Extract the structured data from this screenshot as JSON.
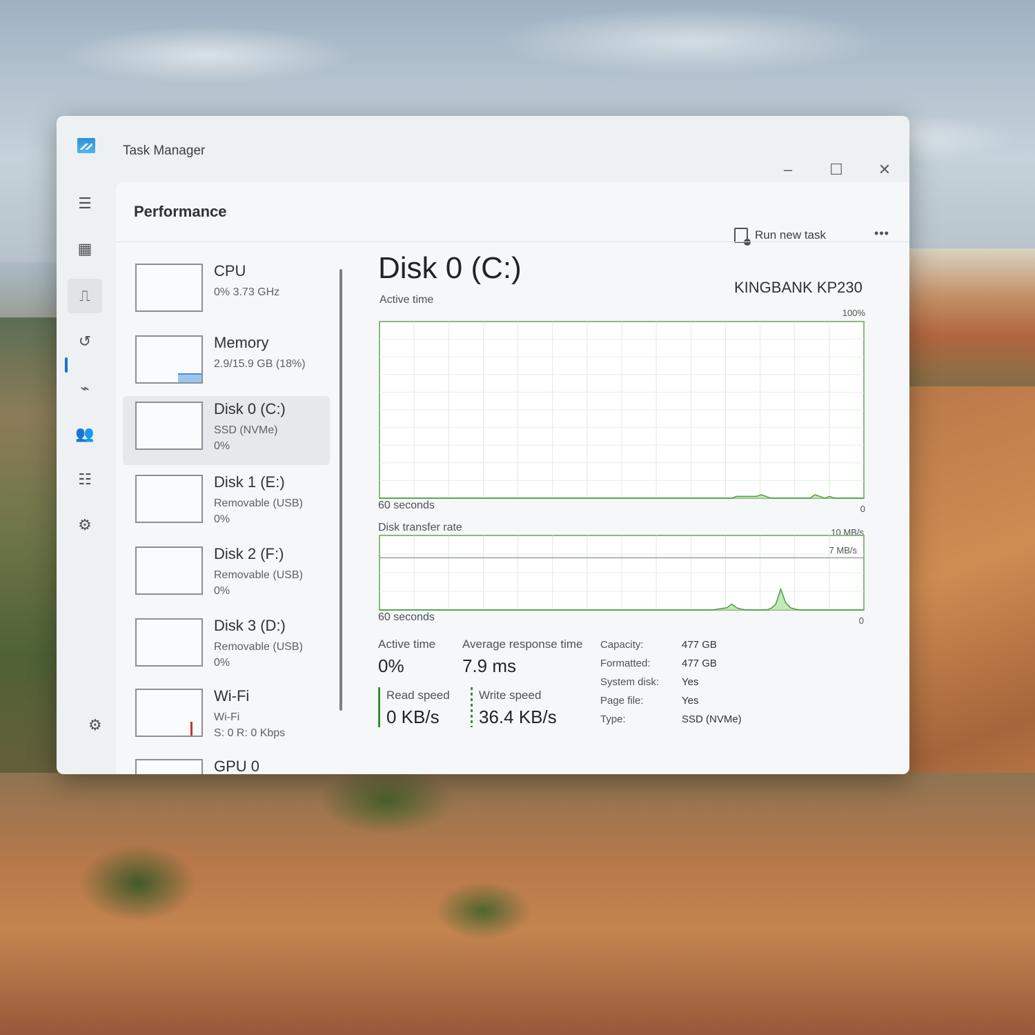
{
  "window": {
    "title": "Task Manager"
  },
  "icons": {
    "app": "task-manager-app-icon",
    "minimize": "minimize-icon",
    "maximize": "maximize-icon",
    "close": "close-icon",
    "run_task": "run-new-task-icon",
    "more": "more-options-icon",
    "settings": "settings-icon"
  },
  "nav": [
    {
      "name": "hamburger-menu-icon",
      "glyph": "☰"
    },
    {
      "name": "processes-icon",
      "glyph": "▦"
    },
    {
      "name": "performance-icon",
      "glyph": "⎍"
    },
    {
      "name": "app-history-icon",
      "glyph": "↺"
    },
    {
      "name": "startup-apps-icon",
      "glyph": "⌁"
    },
    {
      "name": "users-icon",
      "glyph": "👥"
    },
    {
      "name": "details-icon",
      "glyph": "☷"
    },
    {
      "name": "services-icon",
      "glyph": "⚙"
    }
  ],
  "header": {
    "title": "Performance",
    "run_new_task": "Run new task",
    "more": "•••"
  },
  "devices": [
    {
      "name": "CPU",
      "sub1": "0% 3.73 GHz",
      "sub2": "",
      "sub3": ""
    },
    {
      "name": "Memory",
      "sub1": "2.9/15.9 GB (18%)",
      "sub2": "",
      "sub3": ""
    },
    {
      "name": "Disk 0 (C:)",
      "sub1": "SSD (NVMe)",
      "sub2": "0%",
      "sub3": ""
    },
    {
      "name": "Disk 1 (E:)",
      "sub1": "Removable (USB)",
      "sub2": "0%",
      "sub3": ""
    },
    {
      "name": "Disk 2 (F:)",
      "sub1": "Removable (USB)",
      "sub2": "0%",
      "sub3": ""
    },
    {
      "name": "Disk 3 (D:)",
      "sub1": "Removable (USB)",
      "sub2": "0%",
      "sub3": ""
    },
    {
      "name": "Wi-Fi",
      "sub1": "Wi-Fi",
      "sub2": "S: 0 R: 0 Kbps",
      "sub3": ""
    },
    {
      "name": "GPU 0",
      "sub1": "",
      "sub2": "",
      "sub3": ""
    }
  ],
  "memory_usage_fraction": 0.18,
  "detail": {
    "title": "Disk 0 (C:)",
    "model": "KINGBANK KP230",
    "active_chart": {
      "label": "Active time",
      "max_label": "100%",
      "min_label": "0",
      "time_label": "60 seconds"
    },
    "transfer_chart": {
      "label": "Disk transfer rate",
      "max_label": "10 MB/s",
      "mid_label": "7 MB/s",
      "min_label": "0",
      "time_label": "60 seconds"
    },
    "stats": {
      "active_time_label": "Active time",
      "active_time_value": "0%",
      "avg_response_label": "Average response time",
      "avg_response_value": "7.9 ms",
      "read_label": "Read speed",
      "read_value": "0 KB/s",
      "write_label": "Write speed",
      "write_value": "36.4 KB/s"
    },
    "properties": [
      {
        "key": "Capacity:",
        "value": "477 GB"
      },
      {
        "key": "Formatted:",
        "value": "477 GB"
      },
      {
        "key": "System disk:",
        "value": "Yes"
      },
      {
        "key": "Page file:",
        "value": "Yes"
      },
      {
        "key": "Type:",
        "value": "SSD (NVMe)"
      }
    ]
  },
  "colors": {
    "disk_accent": "#4a9e3f",
    "disk_fill": "#b5e3a6",
    "memory_accent": "#4a90d4",
    "wifi_accent": "#c0392b"
  },
  "chart_data": [
    {
      "type": "area",
      "title": "Active time",
      "ylim": [
        0,
        100
      ],
      "x_range_seconds": 60,
      "series": [
        {
          "values": [
            0,
            0,
            0,
            0,
            0,
            0,
            0,
            0,
            0,
            0,
            0,
            0,
            0,
            0,
            0,
            0,
            0,
            0,
            0,
            0,
            0,
            0,
            0,
            0,
            0,
            0,
            0,
            0,
            0,
            0,
            0,
            0,
            0,
            0,
            0,
            0,
            0,
            0,
            0,
            0,
            0,
            0,
            0,
            0,
            0,
            0,
            0,
            0,
            0,
            0,
            0,
            0,
            0,
            0,
            0,
            0,
            0,
            0,
            0,
            0,
            0,
            0,
            0,
            0,
            0,
            0,
            0,
            0,
            0,
            0,
            0,
            0,
            0,
            1,
            1,
            1,
            1,
            1,
            2,
            1,
            0,
            0,
            0,
            0,
            0,
            0,
            0,
            0,
            0,
            2,
            1,
            0,
            1,
            0,
            0,
            0,
            0,
            0,
            0,
            0
          ]
        }
      ]
    },
    {
      "type": "area",
      "title": "Disk transfer rate",
      "ylabel": "MB/s",
      "ylim": [
        0,
        10
      ],
      "reference_line": 7,
      "x_range_seconds": 60,
      "series": [
        {
          "values": [
            0,
            0,
            0,
            0,
            0,
            0,
            0,
            0,
            0,
            0,
            0,
            0,
            0,
            0,
            0,
            0,
            0,
            0,
            0,
            0,
            0,
            0,
            0,
            0,
            0,
            0,
            0,
            0,
            0,
            0,
            0,
            0,
            0,
            0,
            0,
            0,
            0,
            0,
            0,
            0,
            0,
            0,
            0,
            0,
            0,
            0,
            0,
            0,
            0,
            0,
            0,
            0,
            0,
            0,
            0,
            0,
            0,
            0,
            0,
            0,
            0,
            0,
            0,
            0,
            0,
            0,
            0,
            0,
            0,
            0.1,
            0.2,
            0.3,
            0.8,
            0.3,
            0.1,
            0,
            0,
            0,
            0,
            0,
            0.2,
            0.8,
            2.8,
            1.0,
            0.3,
            0.1,
            0,
            0,
            0,
            0,
            0,
            0,
            0,
            0,
            0,
            0,
            0,
            0,
            0,
            0
          ]
        }
      ]
    }
  ]
}
